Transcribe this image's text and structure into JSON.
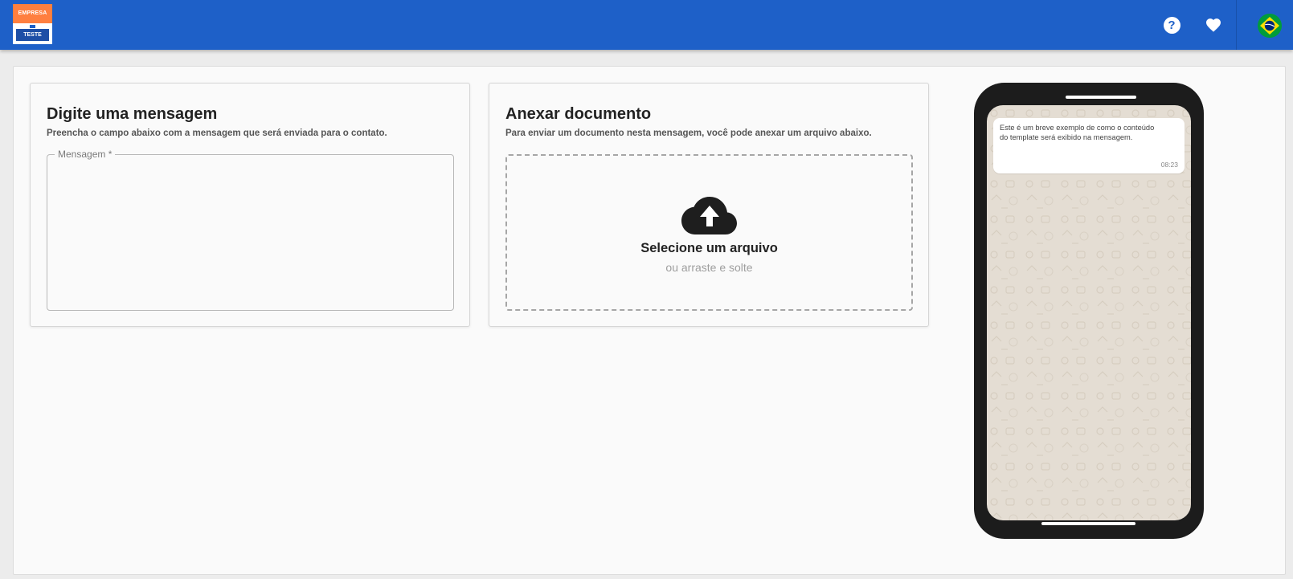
{
  "header": {
    "logo": {
      "top_text": "EMPRESA",
      "bottom_text": "TESTE"
    },
    "help_icon": "question-circle-icon",
    "favorite_icon": "heart-icon",
    "language_flag": "brazil-flag-icon"
  },
  "message_card": {
    "title": "Digite uma mensagem",
    "subtitle": "Preencha o campo abaixo com a mensagem que será enviada para o contato.",
    "field_label": "Mensagem *",
    "field_value": ""
  },
  "document_card": {
    "title": "Anexar documento",
    "subtitle": "Para enviar um documento nesta mensagem, você pode anexar um arquivo abaixo.",
    "dropzone_title": "Selecione um arquivo",
    "dropzone_subtitle": "ou arraste e solte",
    "dropzone_icon": "cloud-upload-icon"
  },
  "preview": {
    "message": "Este é um breve exemplo de como o conteúdo do template será exibido na mensagem.",
    "time": "08:23"
  },
  "colors": {
    "header_bg": "#1e60c8",
    "logo_orange": "#ff7f3f",
    "phone_frame": "#1c1c1c",
    "chat_bg": "#e4ddd3"
  }
}
